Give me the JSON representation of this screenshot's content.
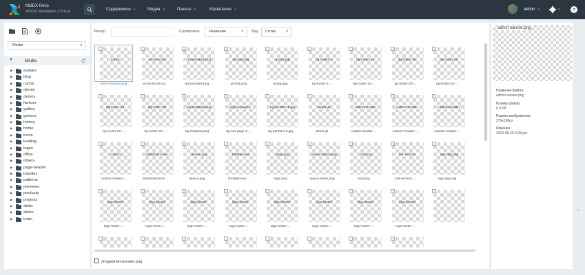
{
  "app": {
    "name": "MODX Revo",
    "version": "MODX Revolution 2.8.6-pl"
  },
  "topnav": {
    "menus": [
      "Содержимое",
      "Медиа",
      "Пакеты",
      "Управление"
    ],
    "user": "admin"
  },
  "left": {
    "source_label": "Media",
    "root_label": "Media",
    "folders": [
      "avatars",
      "blog",
      "cache",
      "clients",
      "demos",
      "favicon",
      "gallery",
      "generic",
      "history",
      "home",
      "icons",
      "landing",
      "logos",
      "office",
      "others",
      "page-header",
      "parallax",
      "patterns",
      "previews",
      "products",
      "projects",
      "slider",
      "slides",
      "team"
    ]
  },
  "toolbar": {
    "filter_label": "Фильтр",
    "filter_value": "",
    "sort_label": "Сортировать",
    "sort_value": "Название",
    "view_label": "Вид",
    "view_value": "Сетка"
  },
  "grid": {
    "files": [
      {
        "alt": "admin-",
        "caption": "admin-banner.png",
        "selected": true
      },
      {
        "alt": "arrow-scroll-",
        "caption": "arrow-scroll-out..."
      },
      {
        "alt": "arrows-dark.png",
        "caption": "arrows-dark.png"
      },
      {
        "alt": "arrows.png",
        "caption": "arrows.png"
      },
      {
        "alt": "avatar.jpg",
        "caption": "avatar.jpg"
      },
      {
        "alt": "bg-footer-1-",
        "caption": "bg-footer-1-..."
      },
      {
        "alt": "bg-footer-14-",
        "caption": "bg-footer-14-..."
      },
      {
        "alt": "bg-footer-20-",
        "caption": "bg-footer-20-..."
      },
      {
        "alt": "bg-footer-20-",
        "caption": "bg-footer-20-..."
      },
      {
        "alt": "bg-footer-20-",
        "caption": "bg-footer-20-..."
      },
      {
        "alt": "bg-footer-20-",
        "caption": "bg-footer-20-..."
      },
      {
        "alt": "bg-hotspots.png",
        "caption": "bg-hotspots.png"
      },
      {
        "alt": "bg-low-page-1-",
        "caption": "bg-low-page-1-..."
      },
      {
        "alt": "bg-portfolio-5.jpg",
        "caption": "bg-portfolio-5.jpg"
      },
      {
        "alt": "blank.gif",
        "caption": "blank.gif"
      },
      {
        "alt": "custom-divider-",
        "caption": "custom-divider-..."
      },
      {
        "alt": "custom-header-",
        "caption": "custom-header-..."
      },
      {
        "alt": "custom-header-",
        "caption": "custom-header-..."
      },
      {
        "alt": "custom-",
        "caption": "custom-header-..."
      },
      {
        "alt": "dashboard-line-",
        "caption": "dashboard-line-..."
      },
      {
        "alt": "device.png",
        "caption": "device.png"
      },
      {
        "alt": "dribbble-line-",
        "caption": "dribbble-line-..."
      },
      {
        "alt": "flags.png",
        "caption": "flags.png"
      },
      {
        "alt": "layout-styles.png",
        "caption": "layout-styles.png"
      },
      {
        "alt": "lazy.png",
        "caption": "lazy.png"
      },
      {
        "alt": "left-section-",
        "caption": "left-section-..."
      },
      {
        "alt": "logo-big.png",
        "caption": "logo-big.png"
      },
      {
        "alt": "logo-footer-",
        "caption": "logo-footer-..."
      },
      {
        "alt": "logo-footer-",
        "caption": "logo-footer-..."
      },
      {
        "alt": "logo-footer-",
        "caption": "logo-footer-..."
      },
      {
        "alt": "logo-footer-",
        "caption": "logo-footer-..."
      },
      {
        "alt": "logo-footer-",
        "caption": "logo-footer-..."
      },
      {
        "alt": "logo-footer-",
        "caption": "logo-footer-..."
      },
      {
        "alt": "logo-footer-",
        "caption": "logo-footer-..."
      },
      {
        "alt": "logo-footer-",
        "caption": "logo-footer-..."
      },
      {
        "alt": "",
        "caption": ""
      },
      {
        "alt": "",
        "caption": ""
      },
      {
        "alt": "",
        "caption": ""
      },
      {
        "alt": "",
        "caption": ""
      },
      {
        "alt": "",
        "caption": ""
      },
      {
        "alt": "",
        "caption": ""
      },
      {
        "alt": "",
        "caption": ""
      },
      {
        "alt": "",
        "caption": ""
      },
      {
        "alt": "",
        "caption": ""
      }
    ]
  },
  "status": {
    "path": "/img/admin-banner.png"
  },
  "details": {
    "preview_alt": "admin-banner.png",
    "name_label": "Название файла:",
    "name_value": "admin-banner.png",
    "size_label": "Размер файла:",
    "size_value": "6.9 KB",
    "dims_label": "Размер изображения:",
    "dims_value": "279x198px",
    "modified_label": "Изменён:",
    "modified_value": "2023-08-26 5:08 pm"
  },
  "colors": {
    "topbar": "#2b3640",
    "accent": "#3a7fc1",
    "background": "#e9edf0"
  }
}
